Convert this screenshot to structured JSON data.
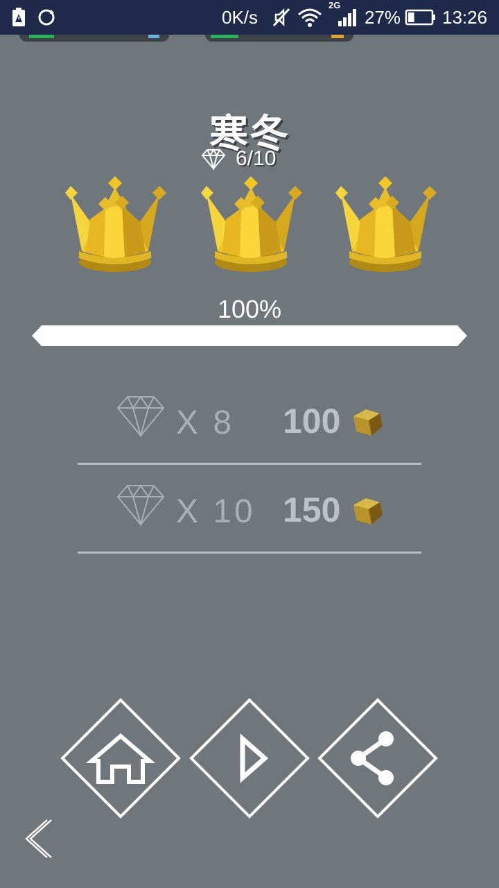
{
  "status_bar": {
    "network_speed": "0K/s",
    "signal_type": "2G",
    "battery_percent": "27%",
    "time": "13:26",
    "battery_level": 0.27,
    "icons": [
      "battery-saver-icon",
      "sync-icon",
      "mute-icon",
      "wifi-icon",
      "signal-icon",
      "battery-icon"
    ]
  },
  "level": {
    "title": "寒冬",
    "gems_collected": "6/10"
  },
  "crowns": {
    "count": 3,
    "earned": 3
  },
  "progress": {
    "label": "100%",
    "fraction": 1.0
  },
  "offers": [
    {
      "multiplier": "X 8",
      "price": "100"
    },
    {
      "multiplier": "X 10",
      "price": "150"
    }
  ],
  "colors": {
    "background": "#6f767c",
    "crown_gold": "#f2c623",
    "coin_gold": "#c9a227",
    "status_bar": "#1f2a4a"
  },
  "nav": [
    "home-icon",
    "play-icon",
    "share-icon"
  ]
}
